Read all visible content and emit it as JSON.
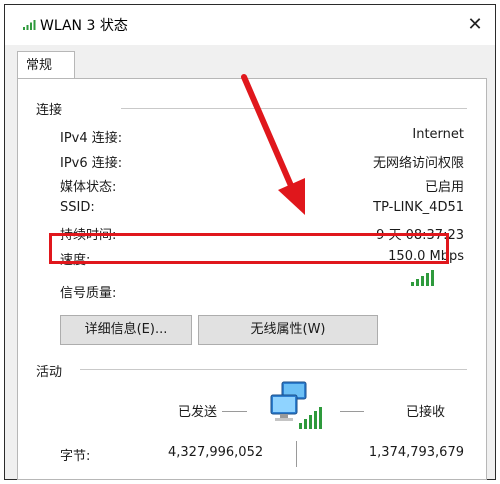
{
  "window": {
    "title": "WLAN 3 状态",
    "close_glyph": "✕"
  },
  "tab": {
    "label": "常规"
  },
  "connection": {
    "heading": "连接",
    "rows": [
      {
        "label": "IPv4 连接:",
        "value": "Internet"
      },
      {
        "label": "IPv6 连接:",
        "value": "无网络访问权限"
      },
      {
        "label": "媒体状态:",
        "value": "已启用"
      },
      {
        "label": "SSID:",
        "value": "TP-LINK_4D51"
      },
      {
        "label": "持续时间:",
        "value": "9 天 08:37:23"
      },
      {
        "label": "速度:",
        "value": "150.0 Mbps"
      }
    ],
    "signal_label": "信号质量:"
  },
  "buttons": {
    "details": "详细信息(E)...",
    "wireless_props": "无线属性(W)"
  },
  "activity": {
    "heading": "活动",
    "sent_label": "已发送",
    "received_label": "已接收",
    "bytes_label": "字节:",
    "sent_bytes": "4,327,996,052",
    "received_bytes": "1,374,793,679"
  },
  "colors": {
    "highlight": "#e0171c",
    "signal": "#2e9a3c"
  },
  "icons": {
    "app": "wifi-signal-icon",
    "network": "network-computers-icon"
  }
}
